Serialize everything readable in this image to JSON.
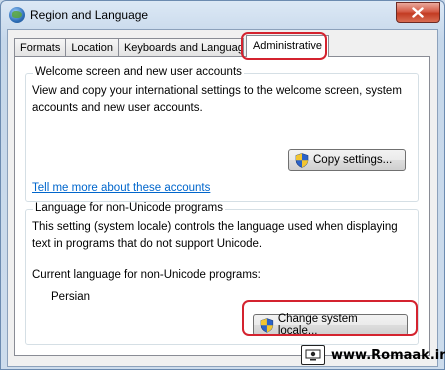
{
  "window": {
    "title": "Region and Language"
  },
  "tabs": [
    {
      "label": "Formats"
    },
    {
      "label": "Location"
    },
    {
      "label": "Keyboards and Languages"
    },
    {
      "label": "Administrative"
    }
  ],
  "welcome": {
    "title": "Welcome screen and new user accounts",
    "description": "View and copy your international settings to the welcome screen, system accounts and new user accounts.",
    "copy_button": "Copy settings...",
    "link": "Tell me more about these accounts"
  },
  "unicode": {
    "title": "Language for non-Unicode programs",
    "description": "This setting (system locale) controls the language used when displaying text in programs that do not support Unicode.",
    "current_label": "Current language for non-Unicode programs:",
    "current_value": "Persian",
    "change_button": "Change system locale..."
  },
  "watermark": {
    "text": "www.Romaak.ir"
  },
  "colors": {
    "highlight": "#d4232f",
    "link": "#0066cc"
  }
}
